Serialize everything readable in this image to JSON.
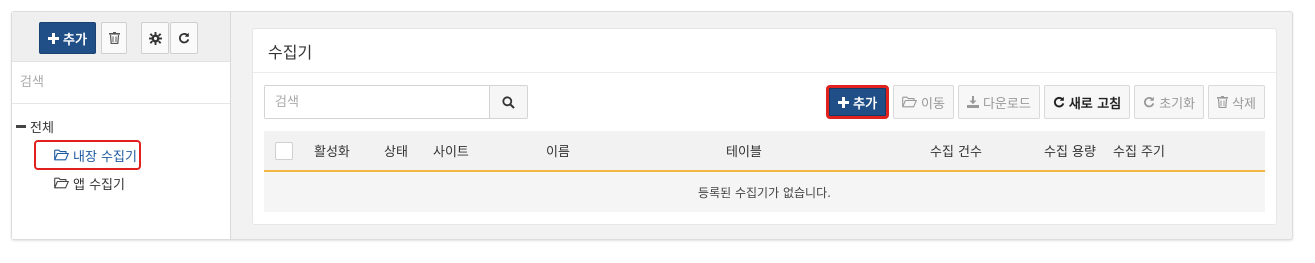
{
  "sidebar": {
    "toolbar": {
      "add_label": "추가"
    },
    "search": {
      "placeholder": "검색"
    },
    "tree": {
      "root_label": "전체",
      "items": [
        {
          "label": "내장 수집기",
          "selected": true
        },
        {
          "label": "앱 수집기",
          "selected": false
        }
      ]
    }
  },
  "main": {
    "title": "수집기",
    "search": {
      "placeholder": "검색"
    },
    "actions": [
      {
        "label": "추가",
        "icon": "plus-icon",
        "state": "primary"
      },
      {
        "label": "이동",
        "icon": "folder-open-icon",
        "state": "disabled"
      },
      {
        "label": "다운로드",
        "icon": "download-icon",
        "state": "disabled"
      },
      {
        "label": "새로 고침",
        "icon": "refresh-icon",
        "state": "enabled"
      },
      {
        "label": "초기화",
        "icon": "reset-icon",
        "state": "disabled"
      },
      {
        "label": "삭제",
        "icon": "trash-icon",
        "state": "disabled"
      }
    ],
    "table": {
      "columns": [
        "활성화",
        "상태",
        "사이트",
        "이름",
        "테이블",
        "수집 건수",
        "수집 용량",
        "수집 주기"
      ],
      "empty_message": "등록된 수집기가 없습니다."
    }
  },
  "colors": {
    "primary": "#1f4f86",
    "highlight": "#e0211e",
    "header_underline": "#f0b743",
    "selected_text": "#1d5aa0"
  }
}
